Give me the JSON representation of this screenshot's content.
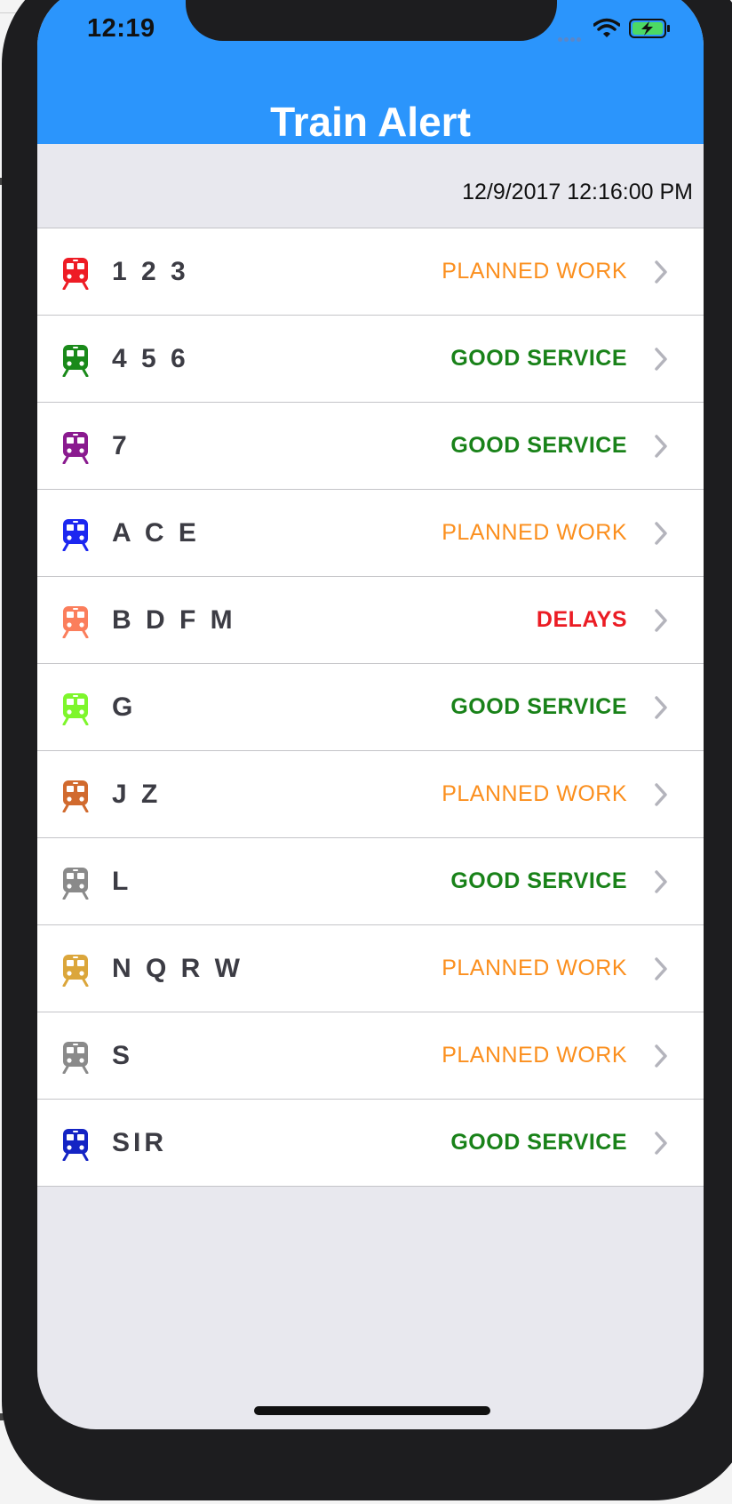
{
  "status_bar": {
    "time": "12:19",
    "icons": [
      "cellular-signal-icon",
      "wifi-icon",
      "battery-charging-icon"
    ]
  },
  "nav": {
    "title": "Train Alert"
  },
  "last_updated": "12/9/2017 12:16:00 PM",
  "colors": {
    "header": "#2b95fc",
    "planned_work": "#fb8f1e",
    "good_service": "#198219",
    "delays": "#eb1c24"
  },
  "lines": [
    {
      "name": "1 2 3",
      "status": "PLANNED WORK",
      "kind": "warn",
      "color": "#ee1c25",
      "icon": "train-icon"
    },
    {
      "name": "4 5 6",
      "status": "GOOD SERVICE",
      "kind": "good",
      "color": "#1a8a1a",
      "icon": "train-icon"
    },
    {
      "name": "7",
      "status": "GOOD SERVICE",
      "kind": "good",
      "color": "#8a1a8f",
      "icon": "train-icon"
    },
    {
      "name": "A C E",
      "status": "PLANNED WORK",
      "kind": "warn",
      "color": "#1c27f0",
      "icon": "train-icon"
    },
    {
      "name": "B D F M",
      "status": "DELAYS",
      "kind": "bad",
      "color": "#fb7e5c",
      "icon": "train-icon"
    },
    {
      "name": "G",
      "status": "GOOD SERVICE",
      "kind": "good",
      "color": "#7ef62c",
      "icon": "train-icon"
    },
    {
      "name": "J Z",
      "status": "PLANNED WORK",
      "kind": "warn",
      "color": "#d16a2e",
      "icon": "train-icon"
    },
    {
      "name": "L",
      "status": "GOOD SERVICE",
      "kind": "good",
      "color": "#8a8a8a",
      "icon": "train-icon"
    },
    {
      "name": "N Q R W",
      "status": "PLANNED WORK",
      "kind": "warn",
      "color": "#dba63b",
      "icon": "train-icon"
    },
    {
      "name": "S",
      "status": "PLANNED WORK",
      "kind": "warn",
      "color": "#8a8a8a",
      "icon": "train-icon"
    },
    {
      "name": "SIR",
      "status": "GOOD SERVICE",
      "kind": "good",
      "color": "#1424c4",
      "icon": "train-icon"
    }
  ]
}
